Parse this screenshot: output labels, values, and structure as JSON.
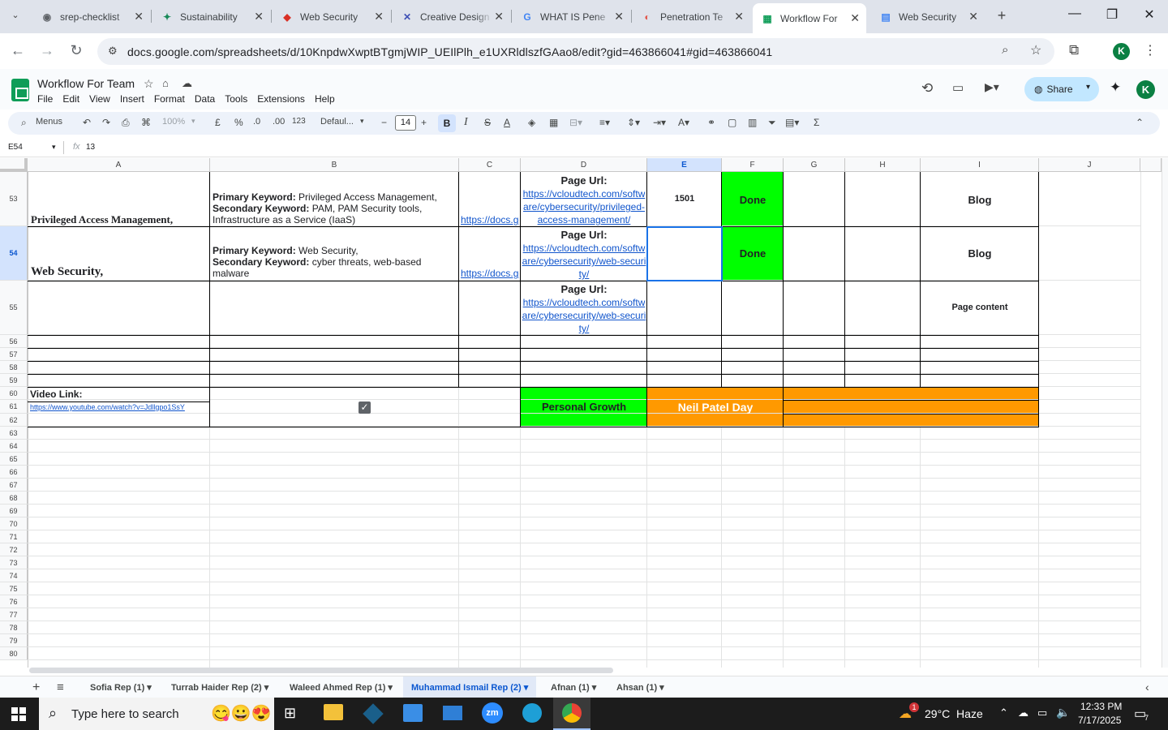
{
  "browser": {
    "tabs": [
      {
        "title": "srep-checklist",
        "icon": "globe-icon",
        "icon_char": "◉",
        "icon_color": "#5f6368"
      },
      {
        "title": "Sustainability",
        "icon": "sparkle-icon",
        "icon_char": "✦",
        "icon_color": "#1a8a5a"
      },
      {
        "title": "Web Security",
        "icon": "shield-icon",
        "icon_char": "◆",
        "icon_color": "#d93025"
      },
      {
        "title": "Creative Design",
        "icon": "x-logo-icon",
        "icon_char": "✕",
        "icon_color": "#3f51b5"
      },
      {
        "title": "WHAT IS Pene",
        "icon": "google-icon",
        "icon_char": "G",
        "icon_color": "#4285f4"
      },
      {
        "title": "Penetration Te",
        "icon": "reader-icon",
        "icon_char": "◐",
        "icon_color": "#e2574c"
      },
      {
        "title": "Workflow For",
        "icon": "sheets-icon",
        "icon_char": "▦",
        "icon_color": "#0f9d58"
      },
      {
        "title": "Web Security",
        "icon": "docs-icon",
        "icon_char": "▤",
        "icon_color": "#4285f4"
      }
    ],
    "active_tab": 6,
    "url": "docs.google.com/spreadsheets/d/10KnpdwXwptBTgmjWIP_UEIlPlh_e1UXRldlszfGAao8/edit?gid=463866041#gid=463866041"
  },
  "sheets": {
    "title": "Workflow For Team",
    "menus": [
      "File",
      "Edit",
      "View",
      "Insert",
      "Format",
      "Data",
      "Tools",
      "Extensions",
      "Help"
    ],
    "share_label": "Share",
    "avatar_letter": "K",
    "toolbar": {
      "search_label": "Menus",
      "zoom": "100%",
      "currency": "£",
      "percent": "%",
      "dec_less": ".0",
      "dec_more": ".00",
      "number_format": "123",
      "font": "Defaul...",
      "font_size": "14",
      "bold": "B",
      "italic": "I",
      "strike": "S",
      "text_color": "A"
    },
    "name_box": "E54",
    "formula_icon": "fx",
    "formula_value": "13"
  },
  "grid": {
    "columns": [
      "A",
      "B",
      "C",
      "D",
      "E",
      "F",
      "G",
      "H",
      "I",
      "J"
    ],
    "selected_column": "E",
    "rows": [
      "53",
      "54",
      "55",
      "56",
      "57",
      "58",
      "59",
      "60",
      "61",
      "62",
      "63",
      "64",
      "65",
      "66",
      "67",
      "68",
      "69",
      "70",
      "71",
      "72",
      "73",
      "74",
      "75",
      "76",
      "77",
      "78",
      "79",
      "80"
    ],
    "selected_row": "54",
    "r53": {
      "a": "Privileged Access Management,",
      "b_pk_label": "Primary Keyword:",
      "b_pk": " Privileged Access Management,",
      "b_sk_label": "Secondary Keyword:",
      "b_sk": " PAM, PAM Security tools, Infrastructure as a Service (IaaS)",
      "c": "https://docs.google.com",
      "d_label": "Page Url:",
      "d_link": "https://vcloudtech.com/software/cybersecurity/privileged-access-management/",
      "e": "1501",
      "f": "Done",
      "i": "Blog"
    },
    "r54": {
      "a": "Web Security,",
      "b_pk_label": "Primary Keyword:",
      "b_pk": " Web Security,",
      "b_sk_label": "Secondary Keyword:",
      "b_sk": " cyber threats, web-based malware",
      "c": "https://docs.google.com",
      "d_label": "Page Url:",
      "d_link": "https://vcloudtech.com/software/cybersecurity/web-security/",
      "f": "Done",
      "i": "Blog"
    },
    "r55": {
      "d_label": "Page Url:",
      "d_link": "https://vcloudtech.com/software/cybersecurity/web-security/",
      "i": "Page content"
    },
    "r60": {
      "video_label": "Video Link:",
      "video_link": "https://www.youtube.com/watch?v=Jdllgpo1SsY",
      "personal_growth": "Personal Growth",
      "neil_patel": "Neil Patel Day"
    }
  },
  "sheet_tabs": [
    {
      "label": "Sofia Rep (1)"
    },
    {
      "label": "Turrab Haider Rep (2)"
    },
    {
      "label": "Waleed Ahmed Rep (1)"
    },
    {
      "label": "Muhammad Ismail Rep (2)"
    },
    {
      "label": "Afnan (1)"
    },
    {
      "label": "Ahsan (1)"
    }
  ],
  "active_sheet": 3,
  "taskbar": {
    "search_placeholder": "Type here to search",
    "weather": "29°C  Haze",
    "weather_badge": "1",
    "time": "12:33 PM",
    "date": "7/17/2025",
    "notification_count": "7"
  },
  "colors": {
    "done_green": "#00ff00",
    "orange": "#ff9900",
    "selection_blue": "#1a73e8",
    "link_blue": "#1155cc"
  }
}
